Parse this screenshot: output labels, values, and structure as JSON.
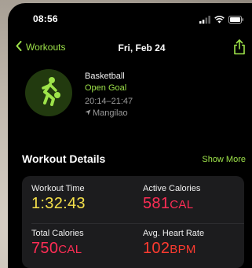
{
  "status_bar": {
    "time": "08:56"
  },
  "nav": {
    "back_label": "Workouts",
    "title": "Fri, Feb 24"
  },
  "workout": {
    "activity": "Basketball",
    "goal": "Open Goal",
    "time_range": "20:14–21:47",
    "location": "Mangilao"
  },
  "details": {
    "section_title": "Workout Details",
    "show_more": "Show More",
    "metrics": [
      {
        "label": "Workout Time",
        "value": "1:32:43",
        "unit": "",
        "color": "#f5e04a"
      },
      {
        "label": "Active Calories",
        "value": "581",
        "unit": "CAL",
        "color": "#ff2d55"
      },
      {
        "label": "Total Calories",
        "value": "750",
        "unit": "CAL",
        "color": "#ff2d55"
      },
      {
        "label": "Avg. Heart Rate",
        "value": "102",
        "unit": "BPM",
        "color": "#ff3b30"
      }
    ]
  },
  "colors": {
    "accent": "#9ee34a",
    "background": "#000000",
    "card": "#1c1c1e",
    "activity_circle": "#223a0f"
  },
  "icons": {
    "back": "chevron-left-icon",
    "share": "share-icon",
    "activity": "basketball-player-icon",
    "location": "location-arrow-icon",
    "signal": "signal-icon",
    "wifi": "wifi-icon",
    "battery": "battery-icon"
  }
}
